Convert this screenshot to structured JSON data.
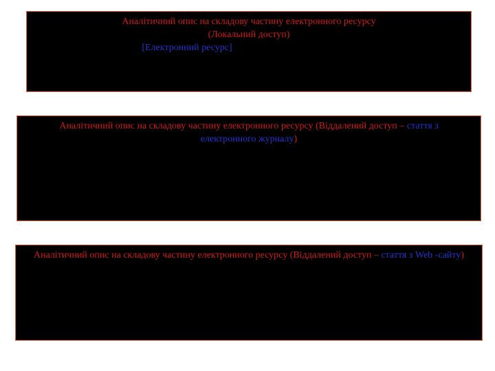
{
  "card1": {
    "title_part1": "Аналітичний опис на складову частину електронного ресурсу (Локальний доступ)",
    "title_part2": "[Електронний ресурс]"
  },
  "card2": {
    "title_prefix": "Аналітичний опис на складову частину електронного ресурсу (Віддалений доступ – ",
    "title_blue": "стаття з електронного журналу",
    "title_suffix": ")"
  },
  "card3": {
    "title_prefix": "Аналітичний опис на складову частину електронного ресурсу (Віддалений доступ – ",
    "title_blue": "стаття з Web -сайту",
    "title_suffix": ")"
  }
}
